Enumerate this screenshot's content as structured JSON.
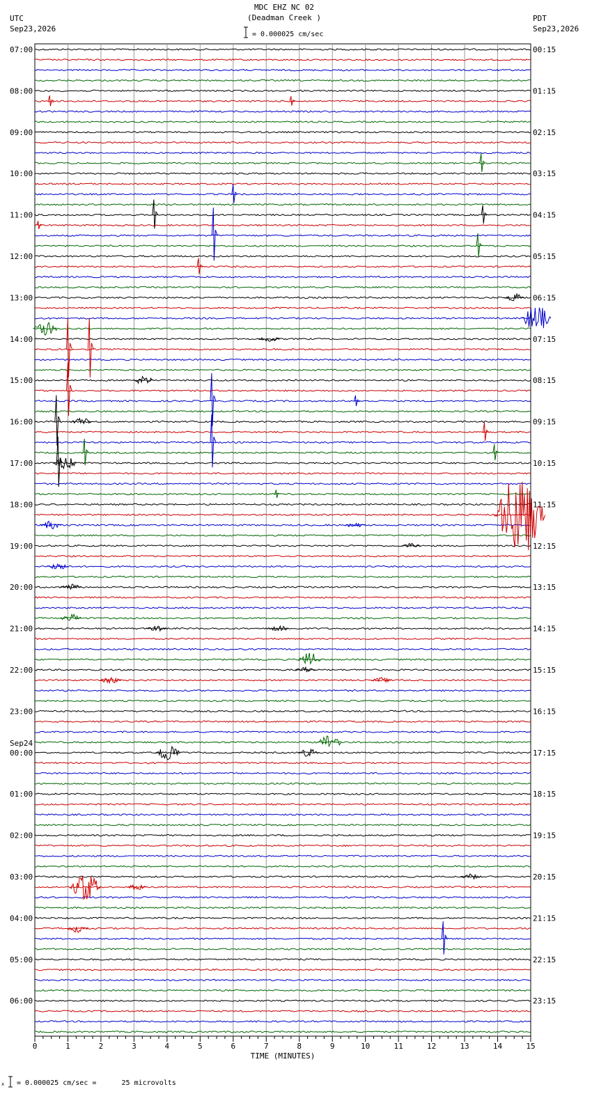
{
  "header": {
    "title": "MDC EHZ NC 02",
    "subtitle": "(Deadman Creek )",
    "scale_text": "= 0.000025 cm/sec",
    "left_tz": "UTC",
    "left_date": "Sep23,2026",
    "right_tz": "PDT",
    "right_date": "Sep23,2026"
  },
  "footer": {
    "scale_text": "= 0.000025 cm/sec =      25 microvolts"
  },
  "chart_data": {
    "type": "line",
    "title": "MDC EHZ NC 02 (Deadman Creek )",
    "xlabel": "TIME (MINUTES)",
    "x_ticks": [
      "0",
      "1",
      "2",
      "3",
      "4",
      "5",
      "6",
      "7",
      "8",
      "9",
      "10",
      "11",
      "12",
      "13",
      "14",
      "15"
    ],
    "xlim": [
      0,
      15
    ],
    "grid": true,
    "trace_colors": [
      "#000000",
      "#cc0000",
      "#0000cc",
      "#006600"
    ],
    "trace_count": 96,
    "left_labels": [
      "07:00",
      "08:00",
      "09:00",
      "10:00",
      "11:00",
      "12:00",
      "13:00",
      "14:00",
      "15:00",
      "16:00",
      "17:00",
      "18:00",
      "19:00",
      "20:00",
      "21:00",
      "22:00",
      "23:00",
      "00:00",
      "01:00",
      "02:00",
      "03:00",
      "04:00",
      "05:00",
      "06:00"
    ],
    "left_day_marker": "Sep24",
    "right_labels": [
      "00:15",
      "01:15",
      "02:15",
      "03:15",
      "04:15",
      "05:15",
      "06:15",
      "07:15",
      "08:15",
      "09:15",
      "10:15",
      "11:15",
      "12:15",
      "13:15",
      "14:15",
      "15:15",
      "16:15",
      "17:15",
      "18:15",
      "19:15",
      "20:15",
      "21:15",
      "22:15",
      "23:15"
    ],
    "events": [
      {
        "trace": 5,
        "minute": 0.45,
        "amplitude": 8,
        "kind": "spike"
      },
      {
        "trace": 5,
        "minute": 7.75,
        "amplitude": 7,
        "kind": "spike"
      },
      {
        "trace": 11,
        "minute": 13.5,
        "amplitude": 14,
        "kind": "spike"
      },
      {
        "trace": 14,
        "minute": 6.0,
        "amplitude": 14,
        "kind": "spike"
      },
      {
        "trace": 16,
        "minute": 3.6,
        "amplitude": 22,
        "kind": "spike"
      },
      {
        "trace": 16,
        "minute": 13.55,
        "amplitude": 14,
        "kind": "spike"
      },
      {
        "trace": 17,
        "minute": 0.1,
        "amplitude": 6,
        "kind": "spike"
      },
      {
        "trace": 18,
        "minute": 5.4,
        "amplitude": 40,
        "kind": "spike"
      },
      {
        "trace": 19,
        "minute": 13.4,
        "amplitude": 18,
        "kind": "spike"
      },
      {
        "trace": 21,
        "minute": 4.95,
        "amplitude": 12,
        "kind": "spike"
      },
      {
        "trace": 24,
        "minute": 14.3,
        "amplitude": 6,
        "kind": "burst"
      },
      {
        "trace": 26,
        "minute": 14.9,
        "amplitude": 20,
        "kind": "burst"
      },
      {
        "trace": 27,
        "minute": 0.1,
        "amplitude": 12,
        "kind": "burst"
      },
      {
        "trace": 28,
        "minute": 6.9,
        "amplitude": 5,
        "kind": "burst"
      },
      {
        "trace": 29,
        "minute": 1.0,
        "amplitude": 45,
        "kind": "spike"
      },
      {
        "trace": 29,
        "minute": 1.65,
        "amplitude": 45,
        "kind": "spike"
      },
      {
        "trace": 32,
        "minute": 3.1,
        "amplitude": 6,
        "kind": "burst"
      },
      {
        "trace": 33,
        "minute": 1.0,
        "amplitude": 40,
        "kind": "spike"
      },
      {
        "trace": 34,
        "minute": 5.35,
        "amplitude": 40,
        "kind": "spike"
      },
      {
        "trace": 34,
        "minute": 9.7,
        "amplitude": 8,
        "kind": "spike"
      },
      {
        "trace": 36,
        "minute": 0.65,
        "amplitude": 38,
        "kind": "spike"
      },
      {
        "trace": 36,
        "minute": 1.2,
        "amplitude": 6,
        "kind": "burst"
      },
      {
        "trace": 37,
        "minute": 13.6,
        "amplitude": 14,
        "kind": "spike"
      },
      {
        "trace": 38,
        "minute": 5.35,
        "amplitude": 40,
        "kind": "spike"
      },
      {
        "trace": 39,
        "minute": 13.9,
        "amplitude": 12,
        "kind": "spike"
      },
      {
        "trace": 39,
        "minute": 1.5,
        "amplitude": 20,
        "kind": "spike"
      },
      {
        "trace": 40,
        "minute": 0.7,
        "amplitude": 38,
        "kind": "spike"
      },
      {
        "trace": 40,
        "minute": 0.7,
        "amplitude": 10,
        "kind": "burst"
      },
      {
        "trace": 43,
        "minute": 7.3,
        "amplitude": 6,
        "kind": "spike"
      },
      {
        "trace": 45,
        "minute": 14.2,
        "amplitude": 60,
        "kind": "burst"
      },
      {
        "trace": 46,
        "minute": 0.3,
        "amplitude": 6,
        "kind": "burst"
      },
      {
        "trace": 46,
        "minute": 9.5,
        "amplitude": 4,
        "kind": "burst"
      },
      {
        "trace": 48,
        "minute": 11.2,
        "amplitude": 4,
        "kind": "burst"
      },
      {
        "trace": 50,
        "minute": 0.5,
        "amplitude": 5,
        "kind": "burst"
      },
      {
        "trace": 52,
        "minute": 0.9,
        "amplitude": 5,
        "kind": "burst"
      },
      {
        "trace": 55,
        "minute": 0.9,
        "amplitude": 6,
        "kind": "burst"
      },
      {
        "trace": 56,
        "minute": 3.5,
        "amplitude": 4,
        "kind": "burst"
      },
      {
        "trace": 56,
        "minute": 7.2,
        "amplitude": 4,
        "kind": "burst"
      },
      {
        "trace": 59,
        "minute": 8.1,
        "amplitude": 10,
        "kind": "burst"
      },
      {
        "trace": 60,
        "minute": 8.0,
        "amplitude": 4,
        "kind": "burst"
      },
      {
        "trace": 61,
        "minute": 2.1,
        "amplitude": 5,
        "kind": "burst"
      },
      {
        "trace": 61,
        "minute": 10.3,
        "amplitude": 4,
        "kind": "burst"
      },
      {
        "trace": 67,
        "minute": 8.7,
        "amplitude": 12,
        "kind": "burst"
      },
      {
        "trace": 68,
        "minute": 3.8,
        "amplitude": 14,
        "kind": "burst"
      },
      {
        "trace": 68,
        "minute": 8.1,
        "amplitude": 6,
        "kind": "burst"
      },
      {
        "trace": 81,
        "minute": 1.25,
        "amplitude": 22,
        "kind": "burst"
      },
      {
        "trace": 81,
        "minute": 2.9,
        "amplitude": 4,
        "kind": "burst"
      },
      {
        "trace": 80,
        "minute": 13.0,
        "amplitude": 4,
        "kind": "burst"
      },
      {
        "trace": 85,
        "minute": 1.1,
        "amplitude": 6,
        "kind": "burst"
      },
      {
        "trace": 86,
        "minute": 12.35,
        "amplitude": 25,
        "kind": "spike"
      }
    ]
  },
  "axis_label": "TIME (MINUTES)"
}
